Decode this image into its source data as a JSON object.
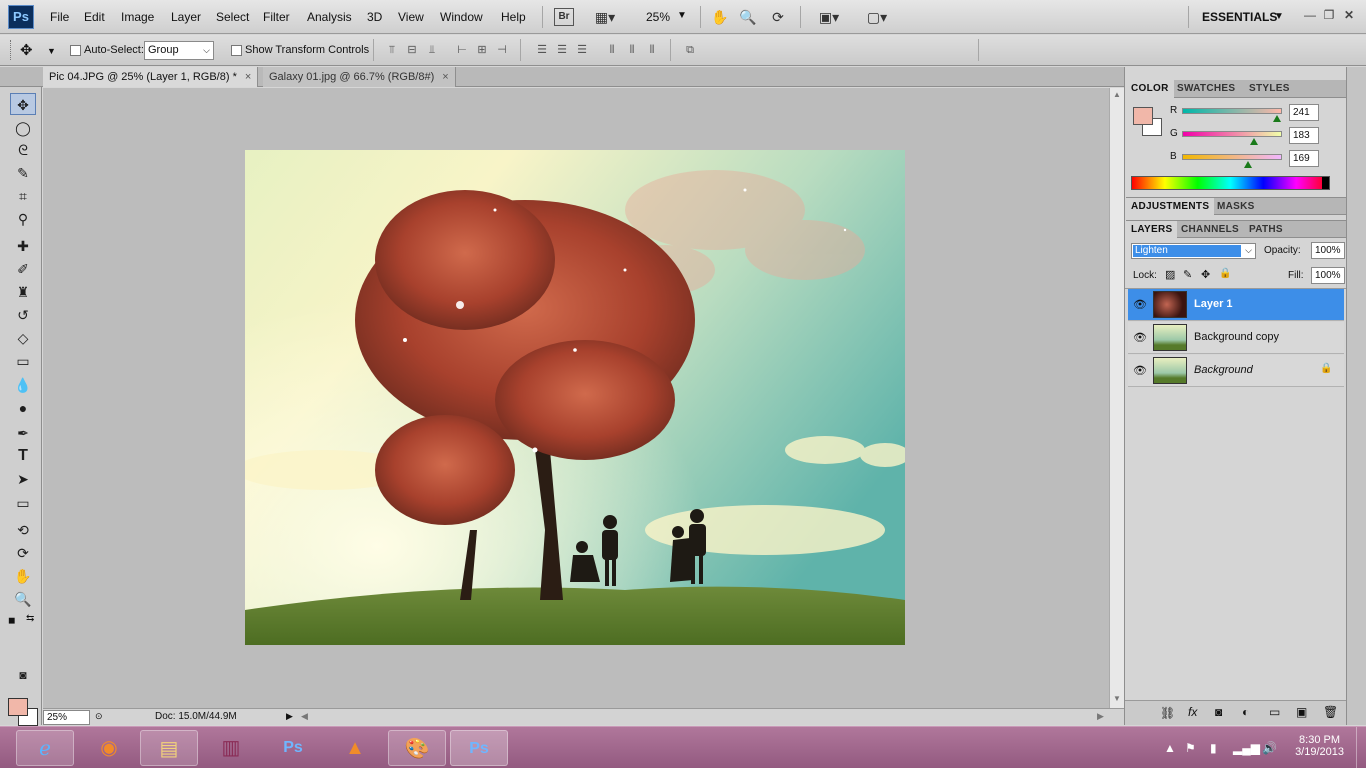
{
  "menu": {
    "logo": "Ps",
    "items": [
      "File",
      "Edit",
      "Image",
      "Layer",
      "Select",
      "Filter",
      "Analysis",
      "3D",
      "View",
      "Window",
      "Help"
    ],
    "bridge": "Br",
    "zoom": "25%",
    "workspace": "ESSENTIALS"
  },
  "options": {
    "auto_select": "Auto-Select:",
    "group_value": "Group",
    "show_transform": "Show Transform Controls"
  },
  "tabs": [
    {
      "label": "Pic 04.JPG @ 25% (Layer 1, RGB/8) *",
      "close": "×"
    },
    {
      "label": "Galaxy 01.jpg @ 66.7% (RGB/8#)",
      "close": "×"
    }
  ],
  "status": {
    "zoom": "25%",
    "doc": "Doc: 15.0M/44.9M"
  },
  "color_panel": {
    "tabs": [
      "COLOR",
      "SWATCHES",
      "STYLES"
    ],
    "r_label": "R",
    "g_label": "G",
    "b_label": "B",
    "r": "241",
    "g": "183",
    "b": "169",
    "fg_color": "#f1b7a9",
    "r_level": 0.945,
    "g_level": 0.718,
    "b_level": 0.663
  },
  "adjust_panel": {
    "tabs": [
      "ADJUSTMENTS",
      "MASKS"
    ]
  },
  "layers_panel": {
    "tabs": [
      "LAYERS",
      "CHANNELS",
      "PATHS"
    ],
    "blend_mode": "Lighten",
    "opacity_label": "Opacity:",
    "opacity": "100%",
    "lock_label": "Lock:",
    "fill_label": "Fill:",
    "fill": "100%",
    "layers": [
      {
        "name": "Layer 1",
        "selected": true
      },
      {
        "name": "Background copy",
        "selected": false
      },
      {
        "name": "Background",
        "selected": false
      }
    ]
  },
  "taskbar": {
    "time": "8:30 PM",
    "date": "3/19/2013"
  }
}
